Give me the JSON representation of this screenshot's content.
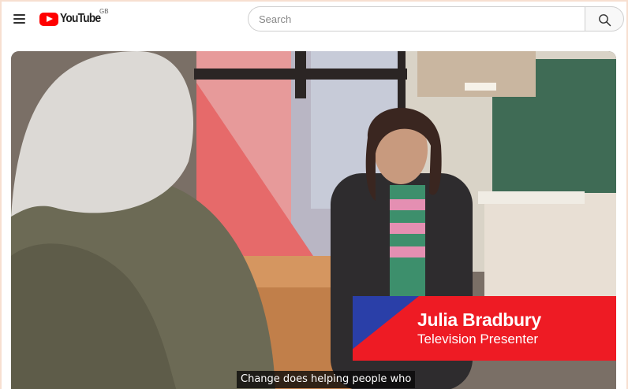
{
  "masthead": {
    "logo_text": "YouTube",
    "region": "GB",
    "search_placeholder": "Search"
  },
  "video": {
    "lower_third": {
      "name": "Julia Bradbury",
      "title": "Television Presenter"
    },
    "caption": "Change does helping people who"
  },
  "colors": {
    "brand_red": "#ff0000",
    "lower_third_red": "#ee1b24",
    "lower_third_blue": "#2a3fa8"
  }
}
